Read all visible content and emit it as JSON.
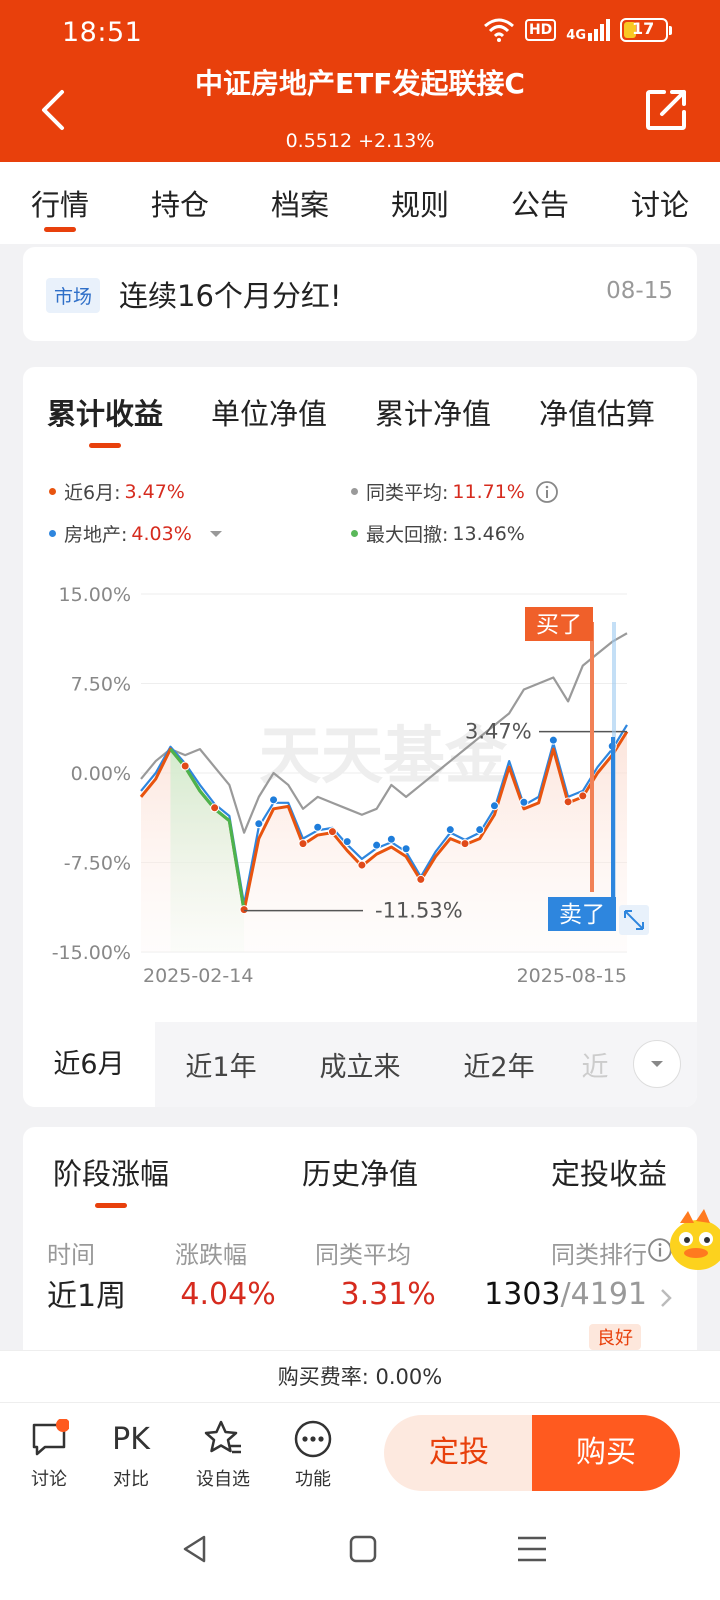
{
  "status_bar": {
    "time": "18:51",
    "network": "4G",
    "hd": "HD",
    "battery": "17"
  },
  "header": {
    "title": "中证房地产ETF发起联接C",
    "subtitle": "0.5512 +2.13%"
  },
  "tabs": [
    {
      "label": "行情",
      "active": true
    },
    {
      "label": "持仓"
    },
    {
      "label": "档案"
    },
    {
      "label": "规则"
    },
    {
      "label": "公告"
    },
    {
      "label": "讨论"
    }
  ],
  "notice": {
    "tag": "市场",
    "text": "连续16个月分红!",
    "date": "08-15"
  },
  "chart_tabs": [
    {
      "label": "累计收益",
      "active": true
    },
    {
      "label": "单位净值"
    },
    {
      "label": "累计净值"
    },
    {
      "label": "净值估算"
    }
  ],
  "legend": {
    "period": {
      "label": "近6月:",
      "value": "3.47%",
      "color": "#e8540f"
    },
    "peer_avg": {
      "label": "同类平均:",
      "value": "11.71%",
      "color": "#9a9a9a"
    },
    "index": {
      "label": "房地产:",
      "value": "4.03%",
      "color": "#2e86de"
    },
    "max_drawdown": {
      "label": "最大回撤:",
      "value": "13.46%",
      "color": "#5ab85a"
    }
  },
  "chart_data": {
    "type": "line",
    "ylim": [
      -15,
      15
    ],
    "yticks": [
      "15.00%",
      "7.50%",
      "0.00%",
      "-7.50%",
      "-15.00%"
    ],
    "xticks": [
      "2025-02-14",
      "2025-08-15"
    ],
    "series": [
      {
        "name": "近6月",
        "color": "#e8540f",
        "values": [
          -2,
          -0.5,
          2,
          0.5,
          -1.5,
          -3,
          -4,
          -11.53,
          -5.5,
          -3,
          -2.8,
          -6,
          -5.2,
          -5,
          -6.5,
          -7.8,
          -6.8,
          -6.2,
          -7,
          -9,
          -7,
          -5.5,
          -6,
          -5.5,
          -3.5,
          0.5,
          -3,
          -2.5,
          2,
          -2.5,
          -2,
          0,
          1.5,
          3.47
        ]
      },
      {
        "name": "房地产",
        "color": "#2e86de",
        "values": [
          -1.5,
          0,
          2.2,
          0.8,
          -1,
          -2.6,
          -3.6,
          -11,
          -4.5,
          -2.5,
          -2.5,
          -5.5,
          -4.8,
          -4.6,
          -6,
          -7.2,
          -6.3,
          -5.8,
          -6.6,
          -8.7,
          -6.6,
          -5,
          -5.6,
          -5,
          -3,
          1,
          -2.7,
          -2,
          2.5,
          -2,
          -1.5,
          0.5,
          2,
          4.03
        ]
      },
      {
        "name": "同类平均",
        "color": "#9a9a9a",
        "values": [
          -0.5,
          1,
          2,
          1.5,
          2,
          0.5,
          -1,
          -5,
          -2,
          0,
          -1,
          -3,
          -2,
          -2.5,
          -3,
          -3.5,
          -3,
          -1,
          -2,
          -1,
          0,
          1,
          2,
          3,
          4,
          5,
          7,
          7.5,
          8,
          6,
          9,
          10,
          11,
          11.71
        ]
      }
    ],
    "annotations": {
      "max_value": "3.47%",
      "min_value": "-11.53%",
      "buy_label": "买了",
      "sell_label": "卖了"
    }
  },
  "period_tabs": [
    {
      "label": "近6月",
      "active": true
    },
    {
      "label": "近1年"
    },
    {
      "label": "成立来"
    },
    {
      "label": "近2年"
    },
    {
      "label": "近"
    }
  ],
  "watermark": "天天基金",
  "stage_tabs": [
    {
      "label": "阶段涨幅",
      "active": true
    },
    {
      "label": "历史净值"
    },
    {
      "label": "定投收益"
    }
  ],
  "stage_table": {
    "headers": [
      "时间",
      "涨跌幅",
      "同类平均",
      "同类排行"
    ],
    "row": {
      "period": "近1周",
      "change": "4.04%",
      "peer": "3.31%",
      "rank": "1303",
      "total": "/4191",
      "badge": "良好"
    }
  },
  "fee": "购买费率: 0.00%",
  "actions": {
    "discuss": "讨论",
    "pk_icon": "PK",
    "compare": "对比",
    "watch": "设自选",
    "more": "功能",
    "auto_invest": "定投",
    "buy": "购买"
  }
}
